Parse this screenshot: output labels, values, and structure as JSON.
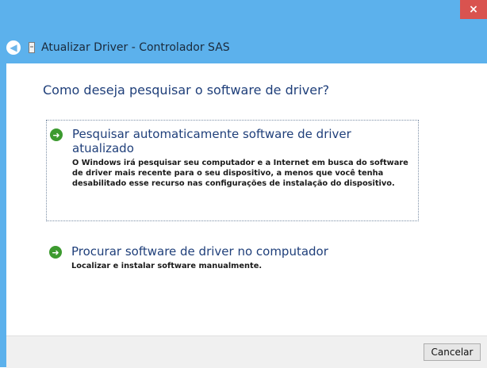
{
  "window": {
    "close_glyph": "×",
    "title": "Atualizar Driver - Controlador SAS"
  },
  "content": {
    "heading": "Como deseja pesquisar o software de driver?",
    "options": [
      {
        "title": "Pesquisar automaticamente software de driver atualizado",
        "description": "O Windows irá pesquisar seu computador e a Internet em busca do software de driver mais recente para o seu dispositivo, a menos que você tenha desabilitado esse recurso nas configurações de instalação do dispositivo."
      },
      {
        "title": "Procurar software de driver no computador",
        "description": "Localizar e instalar software manualmente."
      }
    ]
  },
  "footer": {
    "cancel_label": "Cancelar"
  },
  "colors": {
    "titlebar": "#5cb1ec",
    "close_button": "#d9534f",
    "heading_text": "#1f3f7a",
    "arrow_icon": "#3c9a2f"
  }
}
